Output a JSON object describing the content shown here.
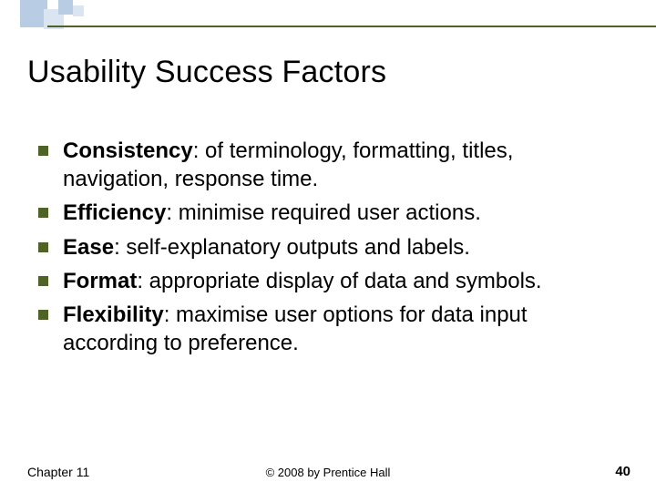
{
  "slide": {
    "title": "Usability Success Factors",
    "bullets": [
      {
        "term": "Consistency",
        "text": ": of terminology, formatting, titles, navigation, response time."
      },
      {
        "term": "Efficiency",
        "text": ": minimise required user actions."
      },
      {
        "term": "Ease",
        "text": ": self-explanatory outputs and labels."
      },
      {
        "term": "Format",
        "text": ": appropriate display of data and symbols."
      },
      {
        "term": "Flexibility",
        "text": ": maximise user options for data input according to preference."
      }
    ],
    "footer": {
      "chapter": "Chapter 11",
      "copyright": "© 2008 by Prentice Hall",
      "page": "40"
    }
  }
}
